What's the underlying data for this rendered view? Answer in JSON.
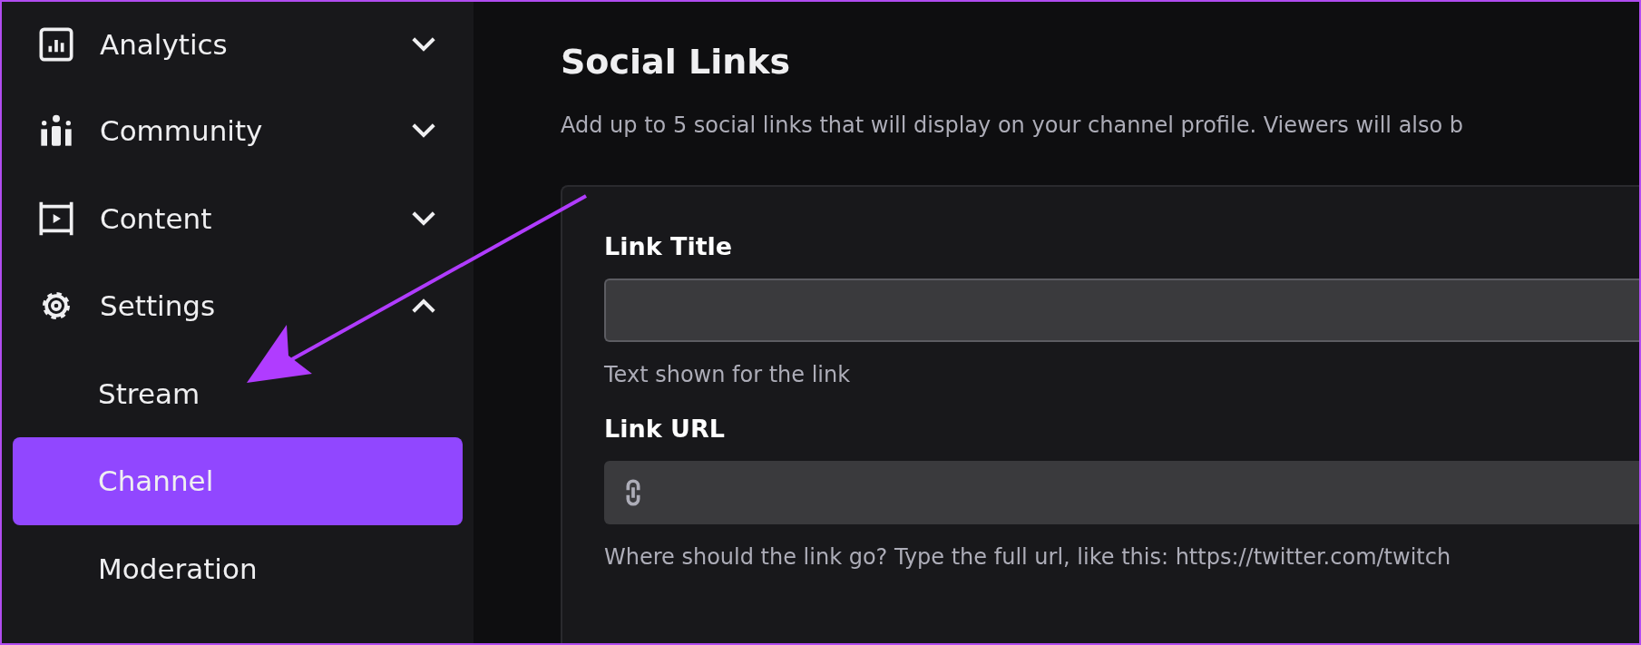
{
  "sidebar": {
    "items": [
      {
        "label": "Analytics",
        "expanded": false
      },
      {
        "label": "Community",
        "expanded": false
      },
      {
        "label": "Content",
        "expanded": false
      },
      {
        "label": "Settings",
        "expanded": true,
        "children": [
          {
            "label": "Stream",
            "selected": false
          },
          {
            "label": "Channel",
            "selected": true
          },
          {
            "label": "Moderation",
            "selected": false
          }
        ]
      }
    ]
  },
  "section": {
    "title": "Social Links",
    "description": "Add up to 5 social links that will display on your channel profile. Viewers will also b",
    "fields": [
      {
        "kind": "text",
        "label": "Link Title",
        "hint": "Text shown for the link"
      },
      {
        "kind": "url",
        "label": "Link URL",
        "hint": "Where should the link go? Type the full url, like this: https://twitter.com/twitch"
      }
    ]
  }
}
